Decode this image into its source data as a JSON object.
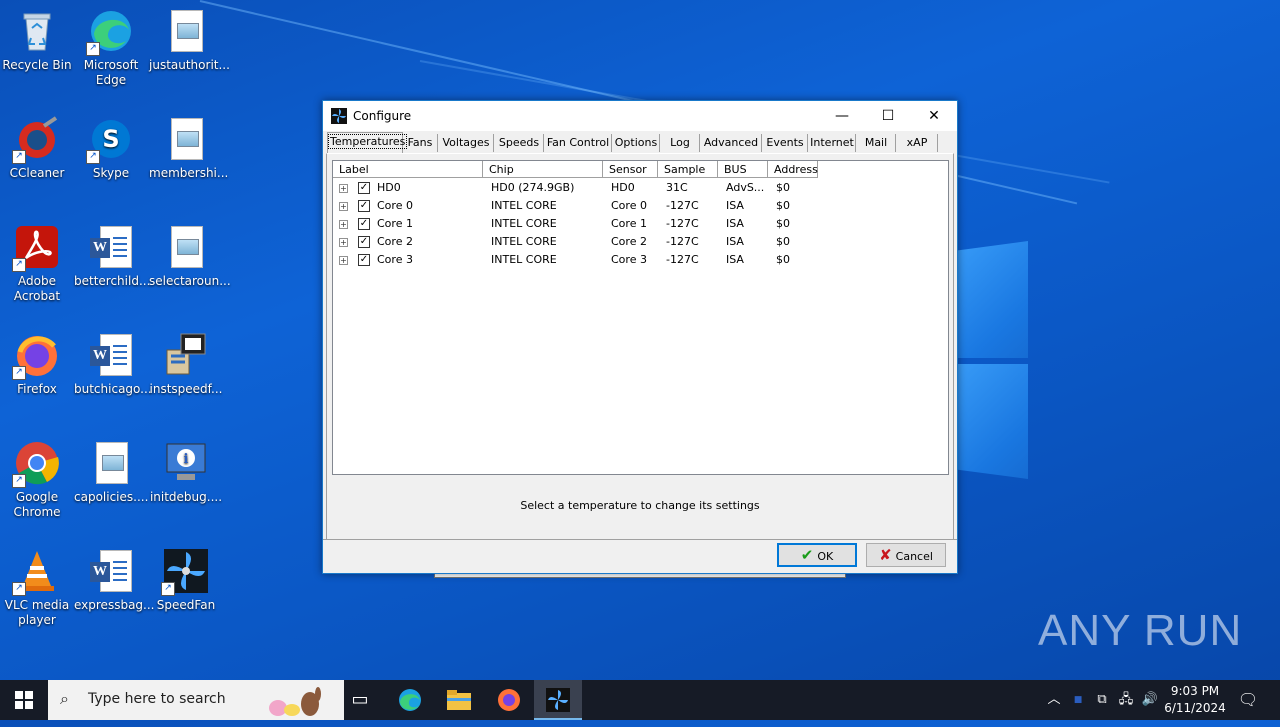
{
  "desktop": {
    "icons": [
      {
        "label": "Recycle Bin"
      },
      {
        "label": "Microsoft Edge"
      },
      {
        "label": "justauthorit..."
      },
      {
        "label": "CCleaner"
      },
      {
        "label": "Skype"
      },
      {
        "label": "membershi..."
      },
      {
        "label": "Adobe Acrobat"
      },
      {
        "label": "betterchild..."
      },
      {
        "label": "selectaroun..."
      },
      {
        "label": "Firefox"
      },
      {
        "label": "butchicago..."
      },
      {
        "label": "instspeedf..."
      },
      {
        "label": "Google Chrome"
      },
      {
        "label": "capolicies...."
      },
      {
        "label": "initdebug...."
      },
      {
        "label": "VLC media player"
      },
      {
        "label": "expressbag..."
      },
      {
        "label": "SpeedFan"
      }
    ],
    "watermark": "ANY RUN"
  },
  "dialog": {
    "title": "Configure",
    "controls": {
      "minimize": "—",
      "maximize": "☐",
      "close": "✕"
    },
    "tabs": [
      "Temperatures",
      "Fans",
      "Voltages",
      "Speeds",
      "Fan Control",
      "Options",
      "Log",
      "Advanced",
      "Events",
      "Internet",
      "Mail",
      "xAP"
    ],
    "active_tab": "Temperatures",
    "columns": [
      "Label",
      "Chip",
      "Sensor",
      "Sample",
      "BUS",
      "Address"
    ],
    "rows": [
      {
        "label": "HD0",
        "chip": "HD0 (274.9GB)",
        "sensor": "HD0",
        "sample": "31C",
        "bus": "AdvS...",
        "address": "$0",
        "checked": true
      },
      {
        "label": "Core 0",
        "chip": "INTEL CORE",
        "sensor": "Core 0",
        "sample": "-127C",
        "bus": "ISA",
        "address": "$0",
        "checked": true
      },
      {
        "label": "Core 1",
        "chip": "INTEL CORE",
        "sensor": "Core 1",
        "sample": "-127C",
        "bus": "ISA",
        "address": "$0",
        "checked": true
      },
      {
        "label": "Core 2",
        "chip": "INTEL CORE",
        "sensor": "Core 2",
        "sample": "-127C",
        "bus": "ISA",
        "address": "$0",
        "checked": true
      },
      {
        "label": "Core 3",
        "chip": "INTEL CORE",
        "sensor": "Core 3",
        "sample": "-127C",
        "bus": "ISA",
        "address": "$0",
        "checked": true
      }
    ],
    "hint": "Select a temperature to change its settings",
    "ok_label": "OK",
    "cancel_label": "Cancel"
  },
  "taskbar": {
    "search_placeholder": "Type here to search",
    "time": "9:03 PM",
    "date": "6/11/2024"
  }
}
